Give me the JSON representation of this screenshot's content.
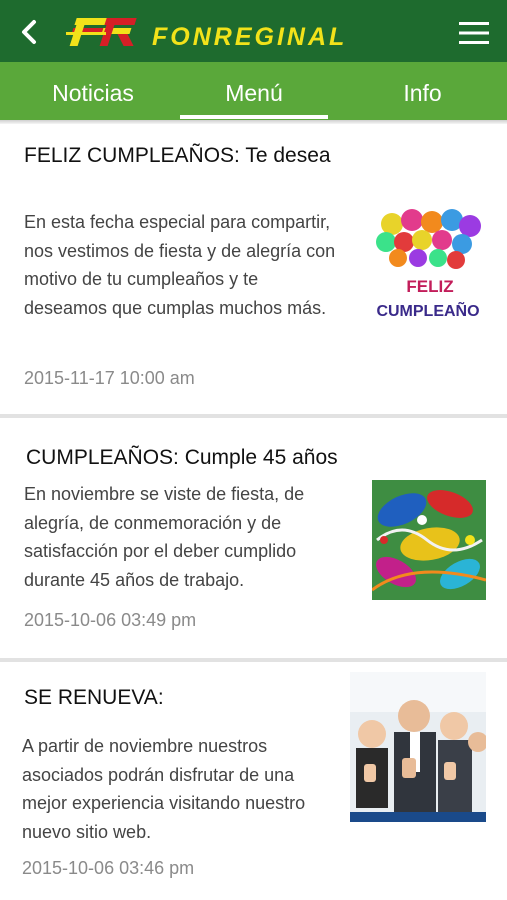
{
  "app": {
    "brand": "FONREGINAL",
    "colors": {
      "header": "#1e6b2e",
      "tabs": "#5aa83a",
      "logo_yellow": "#f2e21a",
      "logo_red": "#d61f26"
    }
  },
  "tabs": [
    {
      "label": "Noticias",
      "selected": false
    },
    {
      "label": "Menú",
      "selected": true
    },
    {
      "label": "Info",
      "selected": false
    }
  ],
  "news": [
    {
      "title": "FELIZ CUMPLEAÑOS: Te desea",
      "body": "En esta fecha especial para compartir, nos vestimos de fiesta y de alegría con motivo de tu cumpleaños y te deseamos que cumplas muchos más.",
      "date": "2015-11-17 10:00 am",
      "image_text_1": "FELIZ",
      "image_text_2": "CUMPLEAÑO"
    },
    {
      "title": "CUMPLEAÑOS:  Cumple 45 años",
      "body": "En noviembre  se viste de fiesta, de alegría, de conmemoración y de satisfacción por el deber cumplido durante 45 años de trabajo.",
      "date": "2015-10-06 03:49 pm"
    },
    {
      "title": "SE RENUEVA:",
      "body": "A partir de noviembre nuestros asociados podrán disfrutar de una mejor experiencia visitando nuestro nuevo sitio web.",
      "date": "2015-10-06 03:46 pm"
    }
  ]
}
